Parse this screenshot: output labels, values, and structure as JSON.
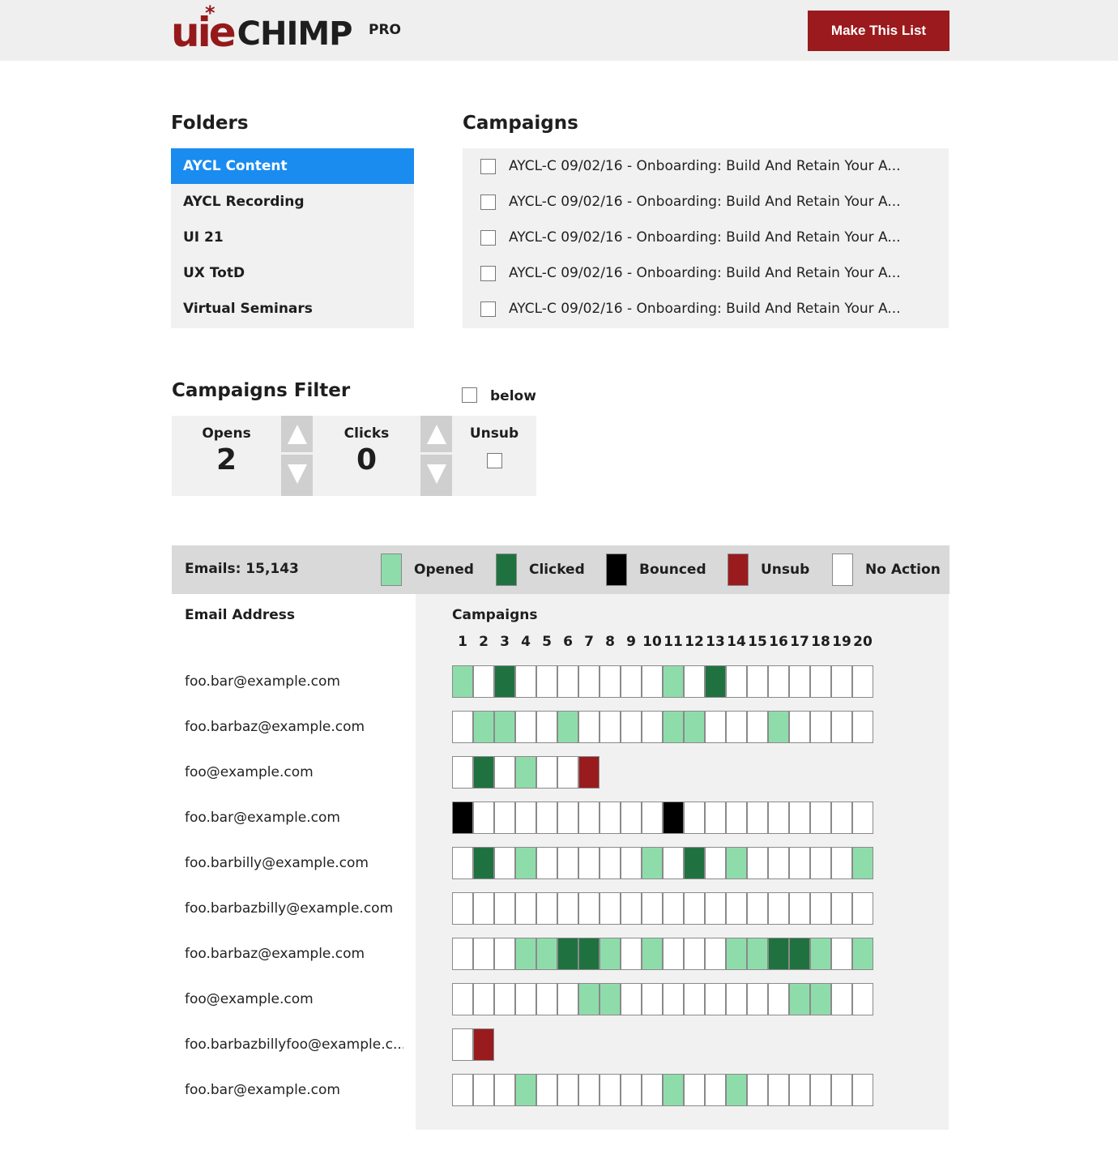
{
  "header": {
    "logo_main": "uie",
    "logo_star": "*",
    "logo_word": "CHIMP",
    "logo_badge": "PRO",
    "action_label": "Make This List"
  },
  "folders": {
    "title": "Folders",
    "items": [
      {
        "label": "AYCL Content",
        "active": true
      },
      {
        "label": "AYCL Recording",
        "active": false
      },
      {
        "label": "UI 21",
        "active": false
      },
      {
        "label": "UX TotD",
        "active": false
      },
      {
        "label": "Virtual Seminars",
        "active": false
      }
    ]
  },
  "campaigns": {
    "title": "Campaigns",
    "items": [
      "AYCL-C 09/02/16 - Onboarding: Build And Retain Your A...",
      "AYCL-C 09/02/16 - Onboarding: Build And Retain Your A...",
      "AYCL-C 09/02/16 - Onboarding: Build And Retain Your A...",
      "AYCL-C 09/02/16 - Onboarding: Build And Retain Your A...",
      "AYCL-C 09/02/16 - Onboarding: Build And Retain Your A..."
    ]
  },
  "filter": {
    "title": "Campaigns Filter",
    "below_label": "below",
    "opens_label": "Opens",
    "opens_value": "2",
    "clicks_label": "Clicks",
    "clicks_value": "0",
    "unsub_label": "Unsub"
  },
  "legend": {
    "emails_label": "Emails: 15,143",
    "items": [
      {
        "key": "O",
        "label": "Opened",
        "color": "#8fdcab"
      },
      {
        "key": "C",
        "label": "Clicked",
        "color": "#1f7240"
      },
      {
        "key": "B",
        "label": "Bounced",
        "color": "#000000"
      },
      {
        "key": "U",
        "label": "Unsub",
        "color": "#9a1b1e"
      },
      {
        "key": "N",
        "label": "No Action",
        "color": "#ffffff"
      }
    ]
  },
  "table": {
    "email_header": "Email Address",
    "campaigns_header": "Campaigns",
    "campaign_numbers": [
      "1",
      "2",
      "3",
      "4",
      "5",
      "6",
      "7",
      "8",
      "9",
      "10",
      "11",
      "12",
      "13",
      "14",
      "15",
      "16",
      "17",
      "18",
      "19",
      "20"
    ],
    "rows": [
      {
        "email": "foo.bar@example.com",
        "statuses": "ONCNNNNNNNONCNNNNNNN"
      },
      {
        "email": "foo.barbaz@example.com",
        "statuses": "NOONNONNNNOONNNONNNN"
      },
      {
        "email": "foo@example.com",
        "statuses": "NCNONNU"
      },
      {
        "email": "foo.bar@example.com",
        "statuses": "BNNNNNNNNNBNNNNNNNNN"
      },
      {
        "email": "foo.barbilly@example.com",
        "statuses": "NCNONNNNNONCNONNNNNO"
      },
      {
        "email": "foo.barbazbilly@example.com",
        "statuses": "NNNNNNNNNNNNNNNNNNNN"
      },
      {
        "email": "foo.barbaz@example.com",
        "statuses": "NNNOOCCONONNNOOCCONO"
      },
      {
        "email": "foo@example.com",
        "statuses": "NNNNNNOONNNNNNNNOONN"
      },
      {
        "email": "foo.barbazbillyfoo@example.c...",
        "statuses": "NU"
      },
      {
        "email": "foo.bar@example.com",
        "statuses": "NNNONNNNNNONNONNNNNN"
      }
    ]
  }
}
